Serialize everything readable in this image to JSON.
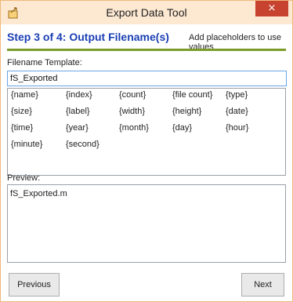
{
  "window": {
    "title": "Export Data Tool",
    "close_label": "×"
  },
  "step": {
    "title": "Step 3 of 4: Output Filename(s)",
    "hint": "Add placeholders to use values"
  },
  "template": {
    "label": "Filename Template:",
    "value": "fS_Exported"
  },
  "placeholders": [
    "{name}",
    "{index}",
    "{count}",
    "{file count}",
    "{type}",
    "{size}",
    "{label}",
    "{width}",
    "{height}",
    "{date}",
    "{time}",
    "{year}",
    "{month}",
    "{day}",
    "{hour}",
    "{minute}",
    "{second}"
  ],
  "preview": {
    "label": "Preview:",
    "value": "fS_Exported.m"
  },
  "buttons": {
    "previous": "Previous",
    "next": "Next"
  },
  "colors": {
    "accent": "#1a3fb4",
    "rule": "#7b9b2a",
    "close": "#c7422f",
    "titlebar": "#fde8d2"
  }
}
